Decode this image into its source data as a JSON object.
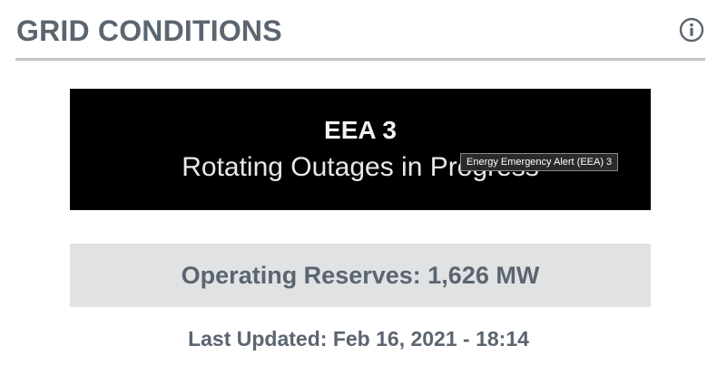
{
  "header": {
    "title": "GRID CONDITIONS",
    "info_icon": "info-circle-icon"
  },
  "banner": {
    "level": "EEA 3",
    "status": "Rotating Outages in Progress",
    "tooltip": "Energy Emergency Alert (EEA) 3",
    "background_color": "#000000"
  },
  "reserves": {
    "text": "Operating Reserves: 1,626 MW"
  },
  "updated": {
    "text": "Last Updated: Feb 16, 2021 - 18:14"
  },
  "colors": {
    "text": "#5b6570",
    "rule": "#c2c4c7",
    "reserves_bg": "#e1e2e4"
  }
}
